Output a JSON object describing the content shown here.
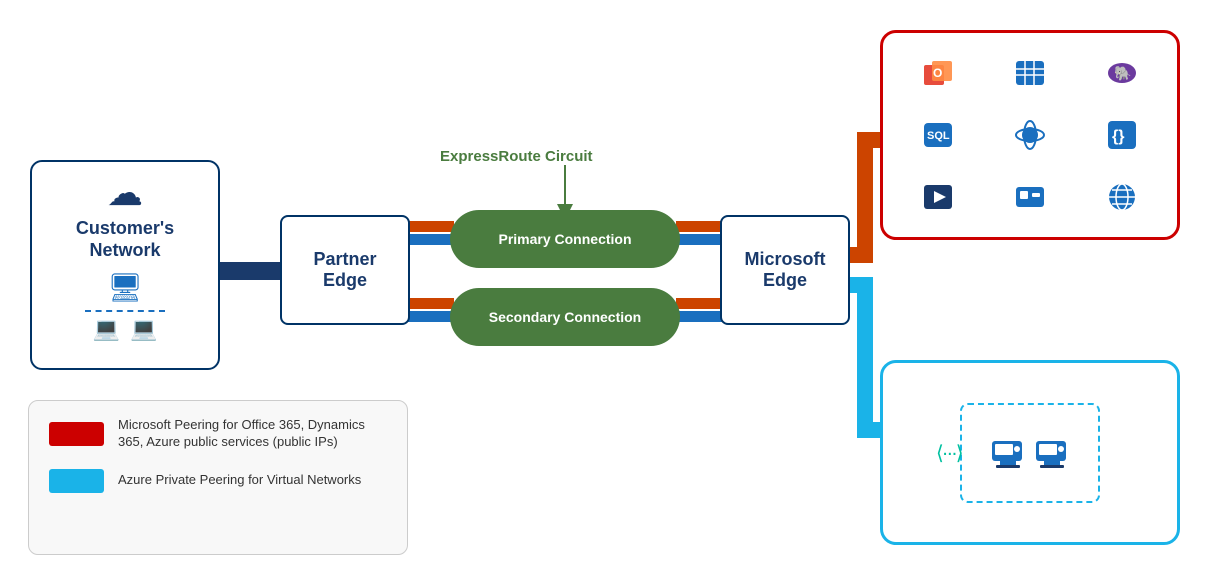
{
  "customer_network": {
    "label_line1": "Customer's",
    "label_line2": "Network"
  },
  "partner_edge": {
    "label_line1": "Partner",
    "label_line2": "Edge"
  },
  "expressroute": {
    "label": "ExpressRoute Circuit"
  },
  "primary_connection": {
    "label": "Primary Connection"
  },
  "secondary_connection": {
    "label": "Secondary Connection"
  },
  "microsoft_edge": {
    "label_line1": "Microsoft",
    "label_line2": "Edge"
  },
  "legend": {
    "item1_text": "Microsoft Peering for Office 365, Dynamics 365, Azure public services (public IPs)",
    "item2_text": "Azure Private Peering for Virtual Networks"
  }
}
